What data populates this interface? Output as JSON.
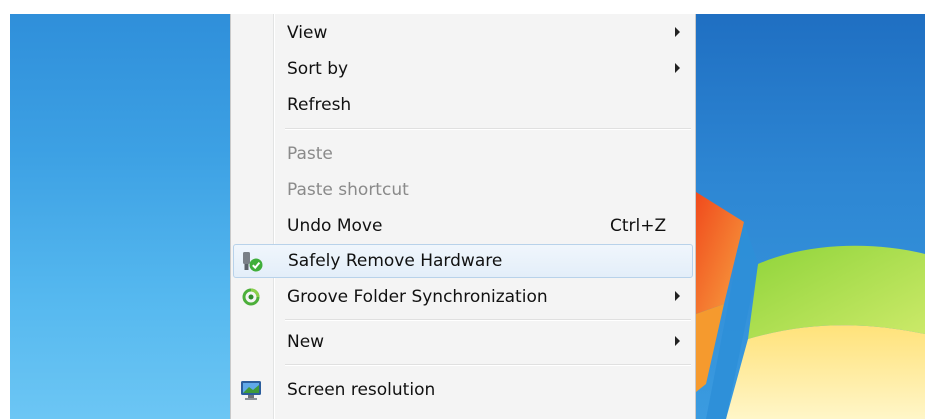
{
  "context_menu": {
    "items": [
      {
        "label": "View",
        "submenu": true,
        "enabled": true
      },
      {
        "label": "Sort by",
        "submenu": true,
        "enabled": true
      },
      {
        "label": "Refresh",
        "submenu": false,
        "enabled": true
      },
      {
        "label": "Paste",
        "submenu": false,
        "enabled": false
      },
      {
        "label": "Paste shortcut",
        "submenu": false,
        "enabled": false
      },
      {
        "label": "Undo Move",
        "shortcut": "Ctrl+Z",
        "submenu": false,
        "enabled": true
      },
      {
        "label": "Safely Remove Hardware",
        "icon": "usb-eject-icon",
        "submenu": false,
        "enabled": true,
        "highlighted": true
      },
      {
        "label": "Groove Folder Synchronization",
        "icon": "groove-sync-icon",
        "submenu": true,
        "enabled": true
      },
      {
        "label": "New",
        "submenu": true,
        "enabled": true
      },
      {
        "label": "Screen resolution",
        "icon": "monitor-icon",
        "submenu": false,
        "enabled": true
      }
    ],
    "colors": {
      "menu_background": "#f4f4f4",
      "disabled_text": "#8a8a8a",
      "highlight_border": "#b8d2ea",
      "desktop_blue": "#3da1e4"
    }
  }
}
